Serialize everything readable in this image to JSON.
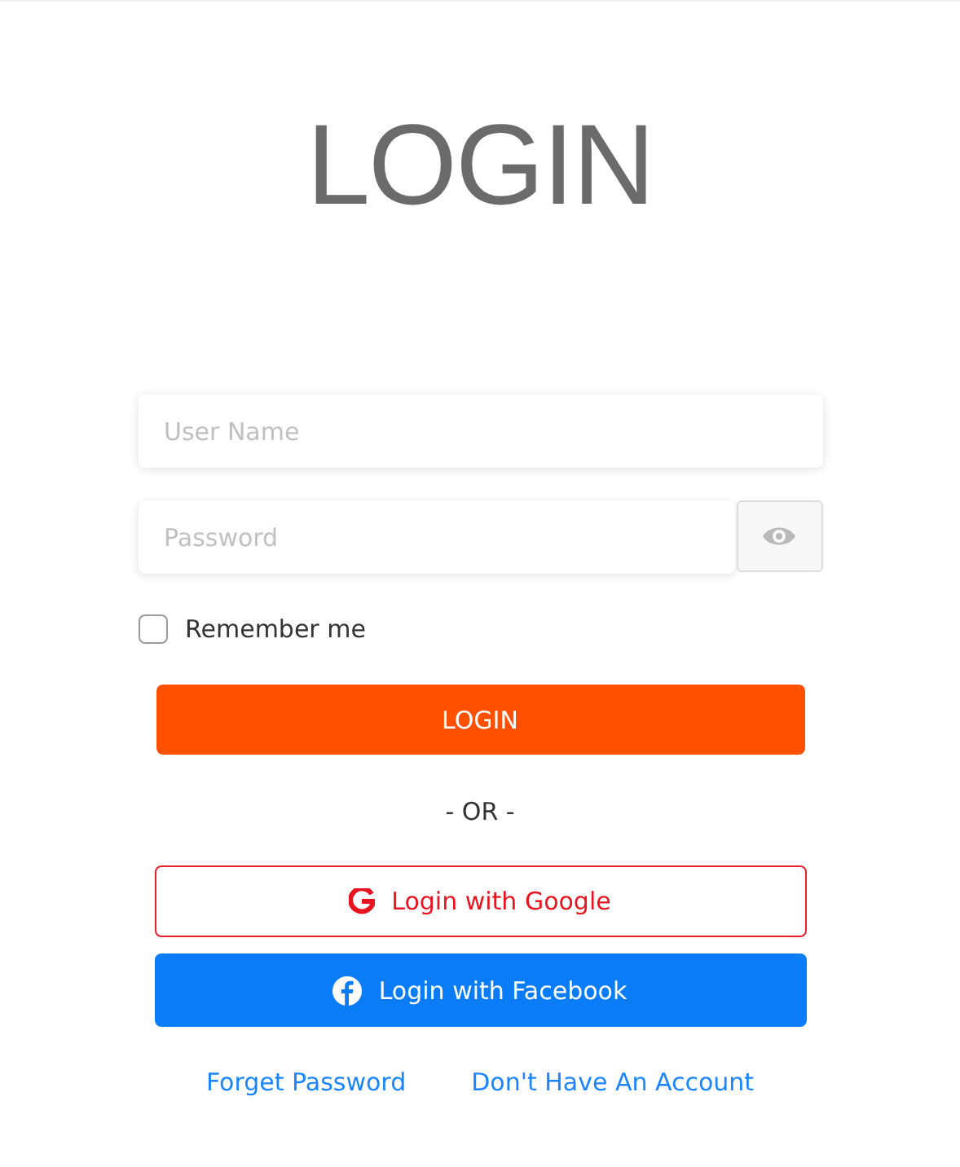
{
  "title": "LOGIN",
  "fields": [
    {
      "kind": "text",
      "placeholder": "User Name"
    },
    {
      "kind": "password",
      "placeholder": "Password"
    }
  ],
  "remember": {
    "label": "Remember me",
    "checked": false
  },
  "login_button": "LOGIN",
  "separator": "- OR -",
  "social_buttons": [
    {
      "kind": "google",
      "label": "Login with Google"
    },
    {
      "kind": "facebook",
      "label": "Login with Facebook"
    }
  ],
  "links": [
    "Forget Password",
    "Don't Have An Account"
  ]
}
